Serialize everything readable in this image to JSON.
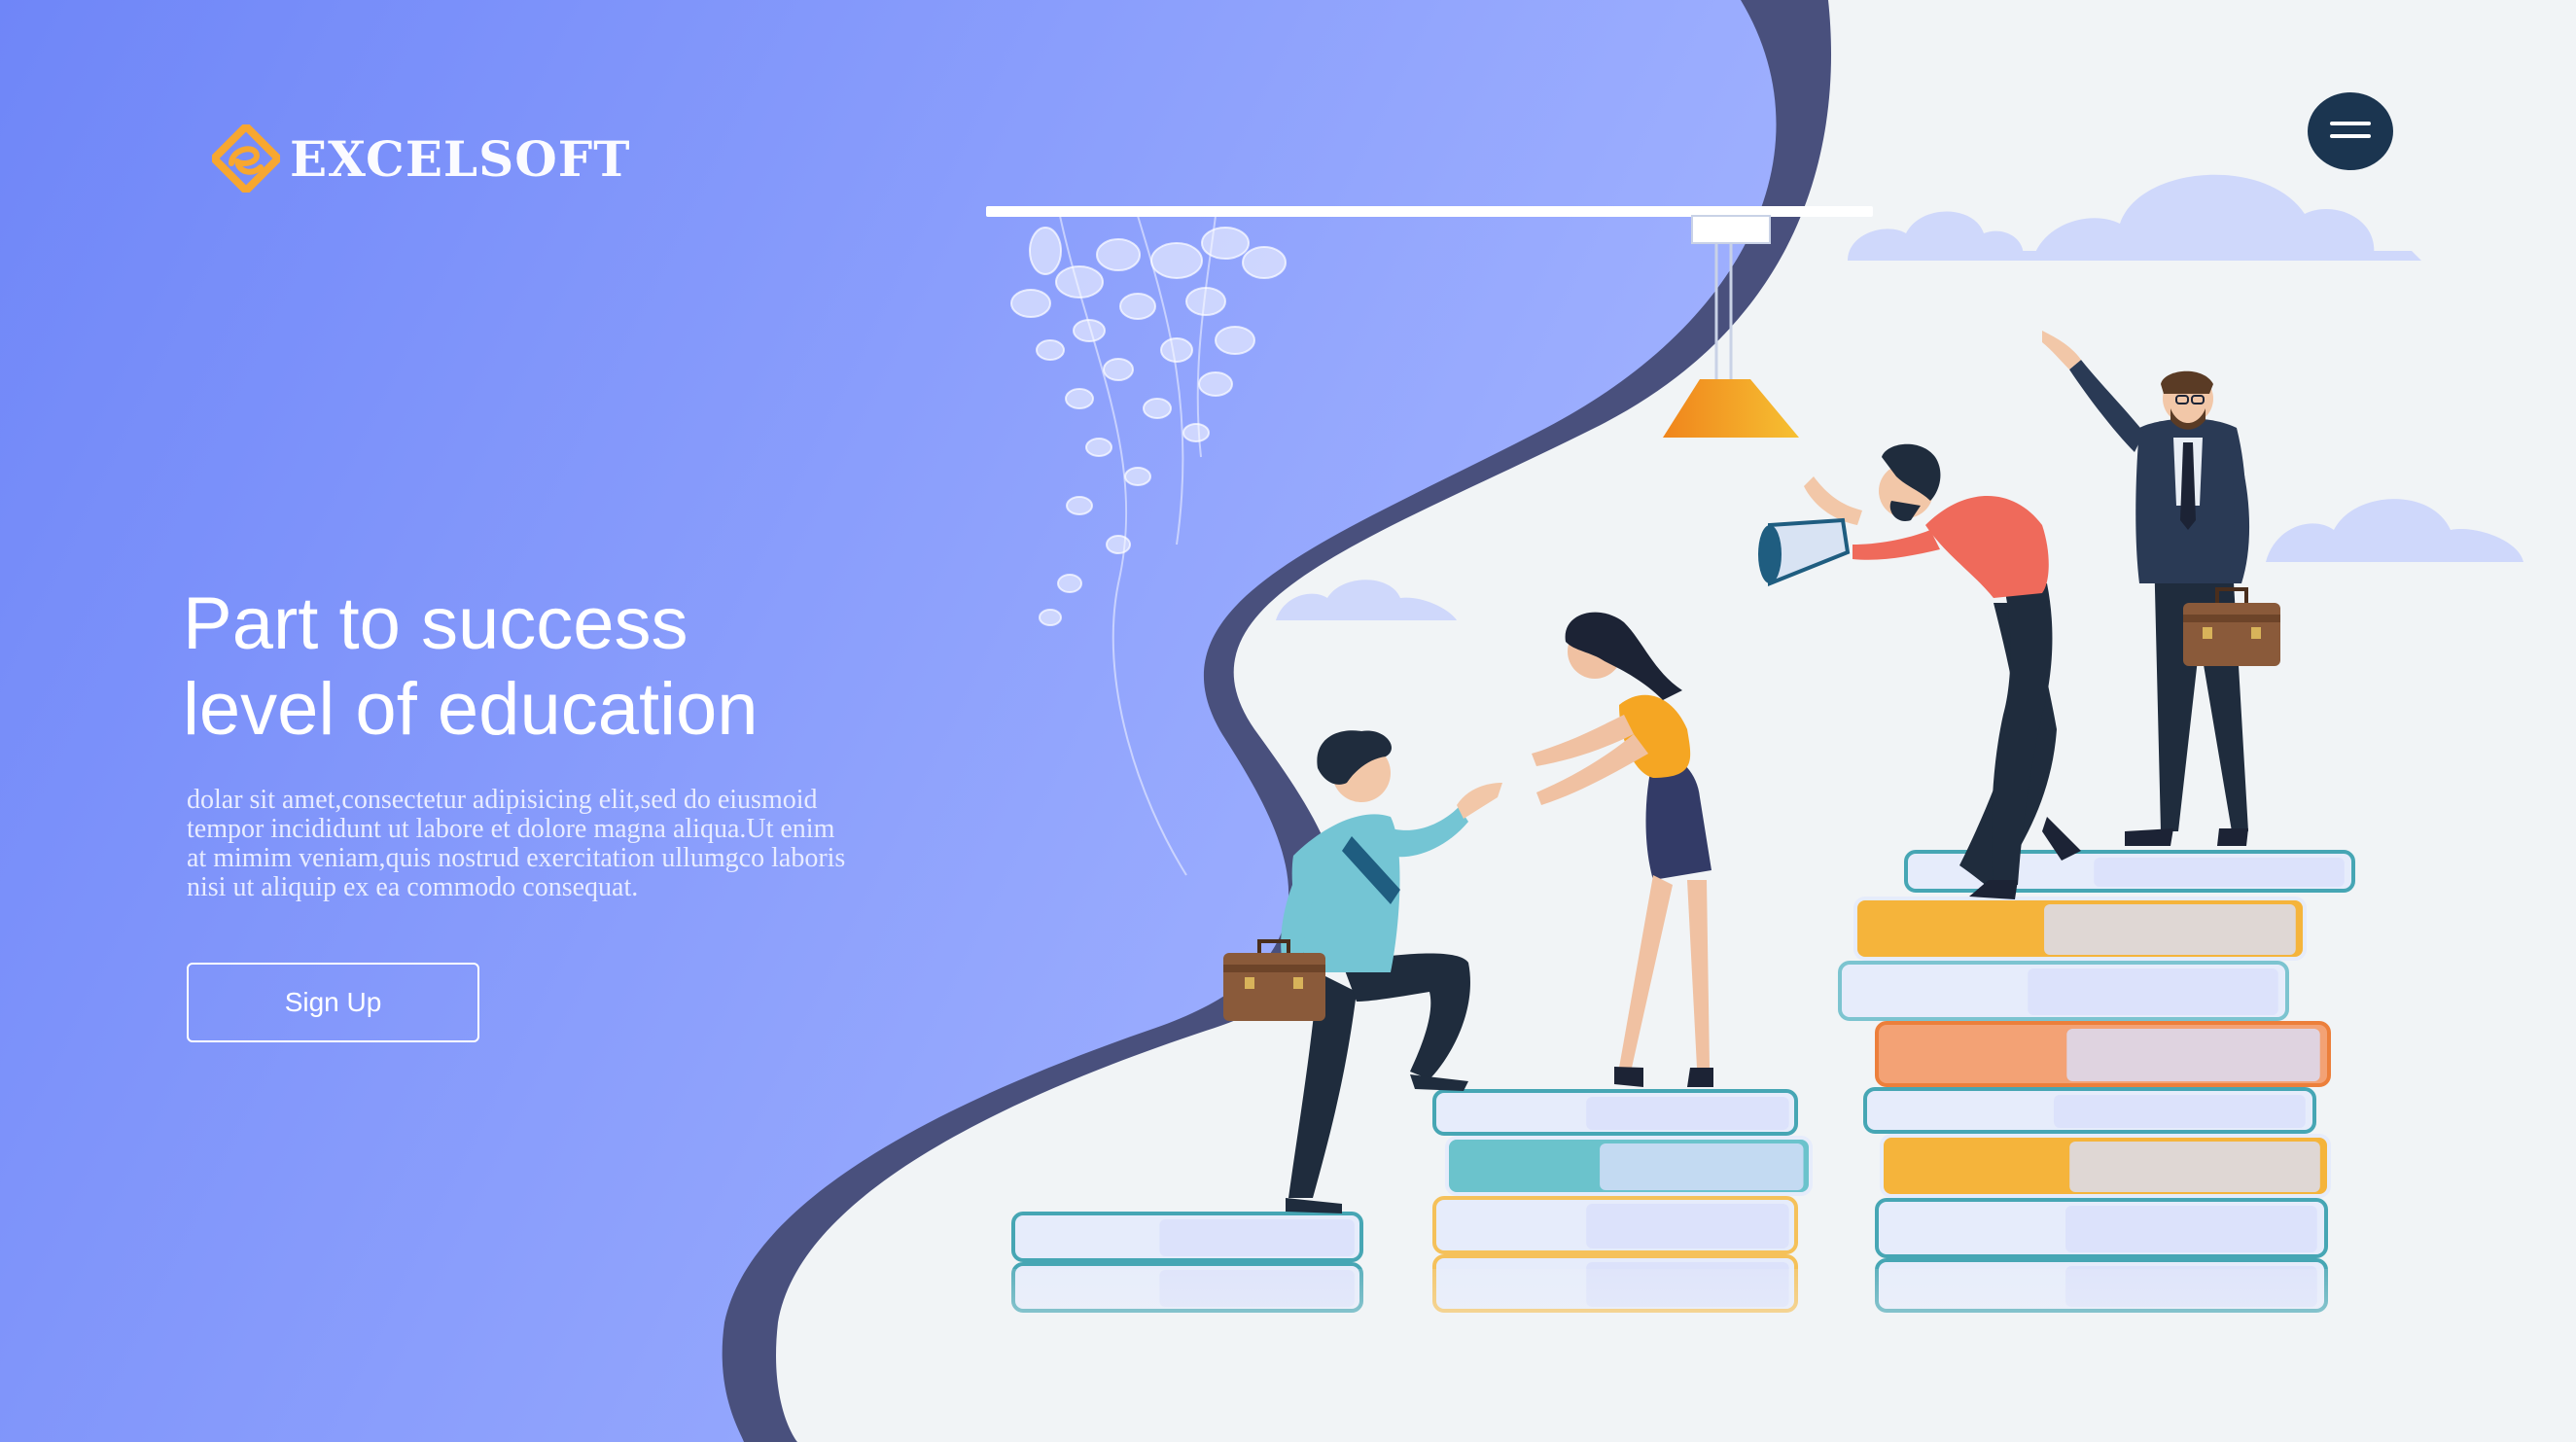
{
  "brand": {
    "name": "EXCELSOFT"
  },
  "menu": {
    "icon": "hamburger-menu-icon"
  },
  "hero": {
    "headline_line1": "Part to success",
    "headline_line2": "level of education",
    "body_lines": [
      "dolar sit amet,consectetur adipisicing elit,sed do eiusmoid",
      "tempor incididunt ut labore et dolore magna aliqua.Ut enim",
      "at mimim veniam,quis nostrud exercitation ullumgco laboris",
      "nisi ut aliquip ex ea commodo consequat."
    ],
    "cta_label": "Sign Up"
  },
  "colors": {
    "hero_blue": "#6f86f8",
    "hero_blue_light": "#9aadff",
    "wave_dark": "#49507d",
    "page_bg": "#f1f4f6",
    "logo_orange": "#f7a730",
    "menu_navy": "#1b3550",
    "lamp_orange": "#f29a1b",
    "cloud": "#cfd8fb"
  },
  "illustration": {
    "icons": [
      "logo-icon",
      "hanging-lamp-icon",
      "vine-plant-icon",
      "cloud-icon",
      "book-stack-icon",
      "person-icon",
      "briefcase-icon",
      "megaphone-icon"
    ]
  }
}
